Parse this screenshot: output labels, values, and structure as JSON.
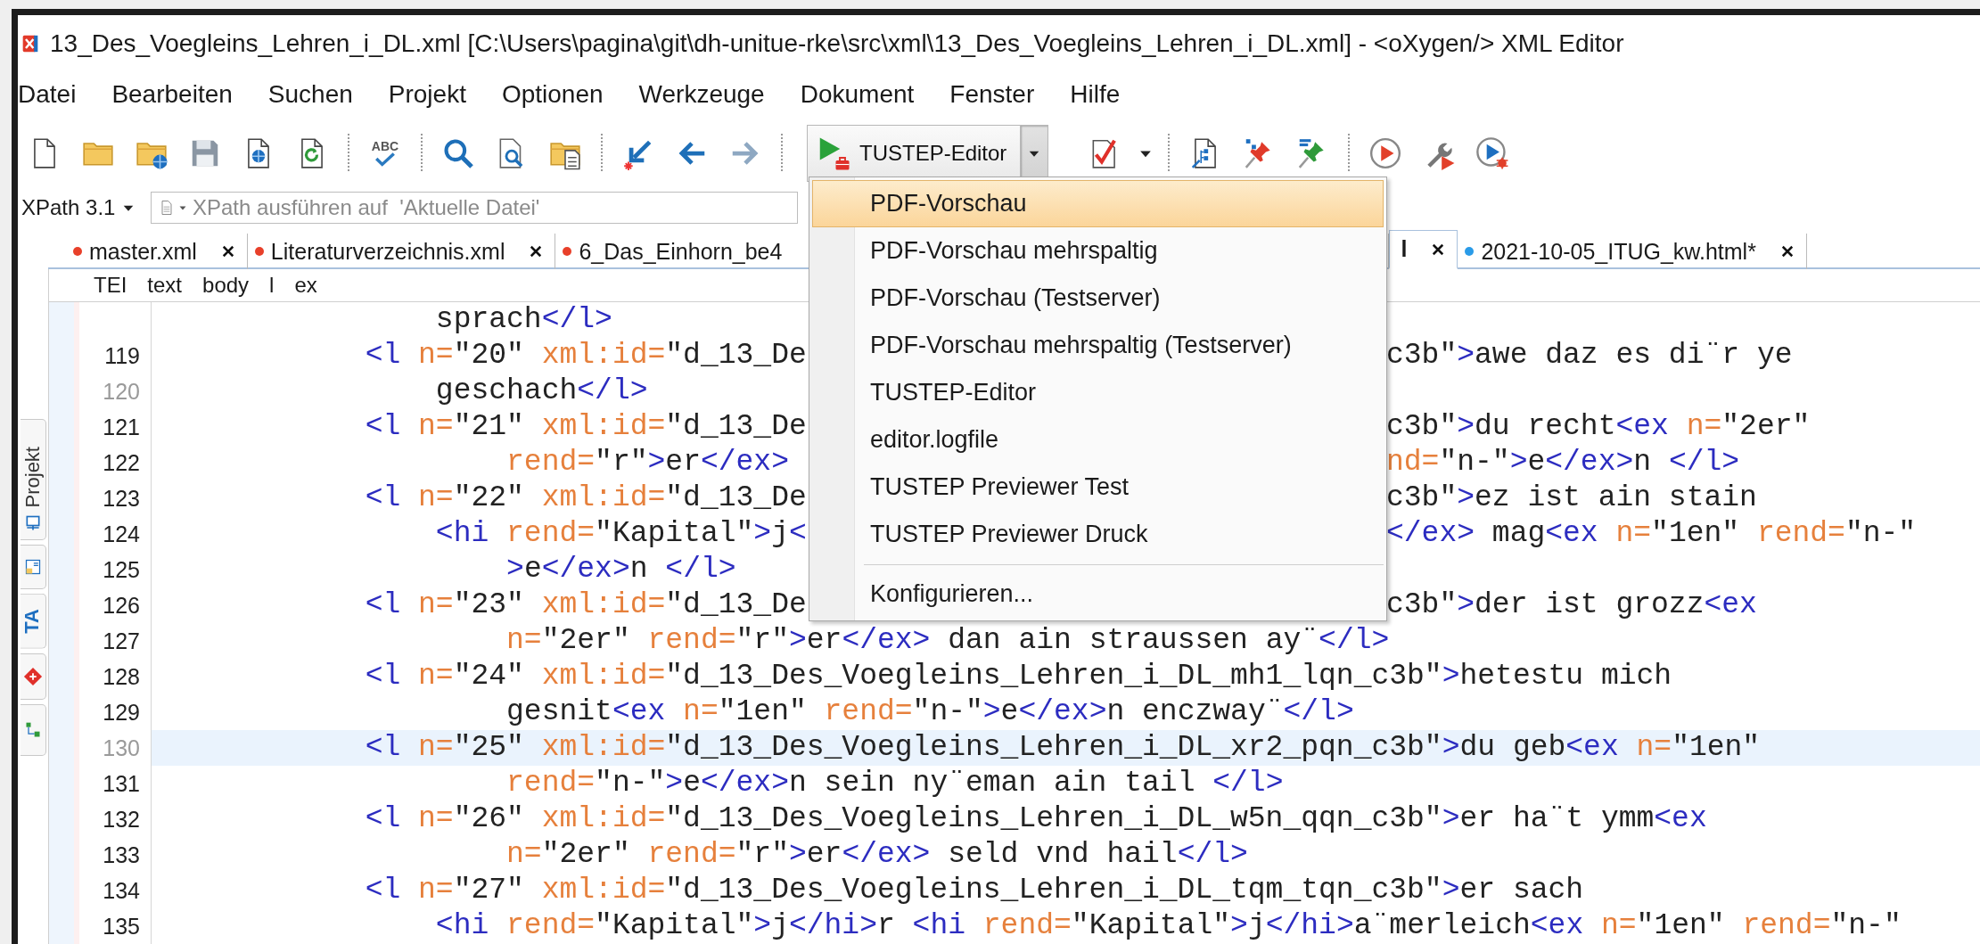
{
  "window": {
    "title": "13_Des_Voegleins_Lehren_i_DL.xml [C:\\Users\\pagina\\git\\dh-unitue-rke\\src\\xml\\13_Des_Voegleins_Lehren_i_DL.xml] - <oXygen/> XML Editor"
  },
  "menu": [
    "Datei",
    "Bearbeiten",
    "Suchen",
    "Projekt",
    "Optionen",
    "Werkzeuge",
    "Dokument",
    "Fenster",
    "Hilfe"
  ],
  "toolbar": {
    "spellcheck_label": "ABC",
    "run_button": {
      "label": "TUSTEP-Editor",
      "expanded": true
    }
  },
  "xpath": {
    "version": "XPath 3.1",
    "placeholder": "XPath ausführen auf  'Aktuelle Datei'"
  },
  "sidebar": {
    "tabs": [
      {
        "kind": "labeled",
        "label": "Projekt"
      },
      {
        "kind": "icon"
      },
      {
        "kind": "text",
        "label": "TA"
      },
      {
        "kind": "icon"
      },
      {
        "kind": "icon"
      }
    ]
  },
  "tabs": [
    {
      "label": "master.xml",
      "color": "#e8402a",
      "selected": false,
      "closable": true
    },
    {
      "label": "Literaturverzeichnis.xml",
      "color": "#e8402a",
      "selected": false,
      "closable": true
    },
    {
      "label": "6_Das_Einhorn_be4",
      "color": "#e8402a",
      "selected": false,
      "closable": false
    },
    {
      "label": "l",
      "selected": true,
      "closable": true
    },
    {
      "label": "2021-10-05_ITUG_kw.html*",
      "color": "#2a9be8",
      "selected": false,
      "closable": true
    }
  ],
  "breadcrumb": [
    "TEI",
    "text",
    "body",
    "l",
    "ex"
  ],
  "lines": [
    {
      "kind": "continuation",
      "current": false,
      "tokens": [
        {
          "kind": "text",
          "text": "sprach"
        },
        {
          "kind": "tag",
          "text": "</l>"
        }
      ]
    },
    {
      "kind": "element",
      "number": "119",
      "number_muted": false,
      "current": false,
      "tokens": [
        {
          "kind": "tag",
          "text": "<l "
        },
        {
          "kind": "attr",
          "text": "n="
        },
        {
          "kind": "text",
          "text": "\"20\" "
        },
        {
          "kind": "attr",
          "text": "xml:id="
        },
        {
          "kind": "text",
          "text": "\"d_13_De"
        }
      ],
      "tokens_right": [
        {
          "kind": "text",
          "text": "c3b\""
        },
        {
          "kind": "tag",
          "text": ">"
        },
        {
          "kind": "text",
          "text": "awe daz es di¨r ye"
        }
      ]
    },
    {
      "kind": "continuation",
      "number": "120",
      "number_muted": true,
      "current": false,
      "tokens": [
        {
          "kind": "text",
          "text": "geschach"
        },
        {
          "kind": "tag",
          "text": "</l>"
        }
      ]
    },
    {
      "kind": "element",
      "number": "121",
      "number_muted": false,
      "current": false,
      "tokens": [
        {
          "kind": "tag",
          "text": "<l "
        },
        {
          "kind": "attr",
          "text": "n="
        },
        {
          "kind": "text",
          "text": "\"21\" "
        },
        {
          "kind": "attr",
          "text": "xml:id="
        },
        {
          "kind": "text",
          "text": "\"d_13_De"
        }
      ],
      "tokens_right": [
        {
          "kind": "text",
          "text": "c3b\""
        },
        {
          "kind": "tag",
          "text": ">"
        },
        {
          "kind": "text",
          "text": "du recht"
        },
        {
          "kind": "tag",
          "text": "<ex "
        },
        {
          "kind": "attr",
          "text": "n="
        },
        {
          "kind": "text",
          "text": "\"2er\""
        }
      ]
    },
    {
      "kind": "attribute",
      "number": "122",
      "number_muted": false,
      "current": false,
      "tokens": [
        {
          "kind": "attr",
          "text": "rend="
        },
        {
          "kind": "text",
          "text": "\"r\""
        },
        {
          "kind": "tag",
          "text": ">"
        },
        {
          "kind": "text",
          "text": "er"
        },
        {
          "kind": "tag",
          "text": "</ex>"
        }
      ],
      "tokens_right": [
        {
          "kind": "attr",
          "text": "nd="
        },
        {
          "kind": "text",
          "text": "\"n-\""
        },
        {
          "kind": "tag",
          "text": ">"
        },
        {
          "kind": "text",
          "text": "e"
        },
        {
          "kind": "tag",
          "text": "</ex>"
        },
        {
          "kind": "text",
          "text": "n "
        },
        {
          "kind": "tag",
          "text": "</l>"
        }
      ]
    },
    {
      "kind": "element",
      "number": "123",
      "number_muted": false,
      "current": false,
      "tokens": [
        {
          "kind": "tag",
          "text": "<l "
        },
        {
          "kind": "attr",
          "text": "n="
        },
        {
          "kind": "text",
          "text": "\"22\" "
        },
        {
          "kind": "attr",
          "text": "xml:id="
        },
        {
          "kind": "text",
          "text": "\"d_13_De"
        }
      ],
      "tokens_right": [
        {
          "kind": "text",
          "text": "c3b\""
        },
        {
          "kind": "tag",
          "text": ">"
        },
        {
          "kind": "text",
          "text": "ez ist ain stain"
        }
      ]
    },
    {
      "kind": "continuation",
      "number": "124",
      "number_muted": false,
      "current": false,
      "tokens": [
        {
          "kind": "tag",
          "text": "<hi "
        },
        {
          "kind": "attr",
          "text": "rend="
        },
        {
          "kind": "text",
          "text": "\"Kapital\""
        },
        {
          "kind": "tag",
          "text": ">"
        },
        {
          "kind": "text",
          "text": "j"
        },
        {
          "kind": "tag",
          "text": "<"
        }
      ],
      "tokens_right": [
        {
          "kind": "tag",
          "text": "</ex>"
        },
        {
          "kind": "text",
          "text": " mag"
        },
        {
          "kind": "tag",
          "text": "<ex "
        },
        {
          "kind": "attr",
          "text": "n="
        },
        {
          "kind": "text",
          "text": "\"1en\" "
        },
        {
          "kind": "attr",
          "text": "rend="
        },
        {
          "kind": "text",
          "text": "\"n-\""
        }
      ]
    },
    {
      "kind": "attribute",
      "number": "125",
      "number_muted": false,
      "current": false,
      "tokens": [
        {
          "kind": "tag",
          "text": ">"
        },
        {
          "kind": "text",
          "text": "e"
        },
        {
          "kind": "tag",
          "text": "</ex>"
        },
        {
          "kind": "text",
          "text": "n "
        },
        {
          "kind": "tag",
          "text": "</l>"
        }
      ]
    },
    {
      "kind": "element",
      "number": "126",
      "number_muted": false,
      "current": false,
      "tokens": [
        {
          "kind": "tag",
          "text": "<l "
        },
        {
          "kind": "attr",
          "text": "n="
        },
        {
          "kind": "text",
          "text": "\"23\" "
        },
        {
          "kind": "attr",
          "text": "xml:id="
        },
        {
          "kind": "text",
          "text": "\"d_13_De"
        }
      ],
      "tokens_right": [
        {
          "kind": "text",
          "text": "c3b\""
        },
        {
          "kind": "tag",
          "text": ">"
        },
        {
          "kind": "text",
          "text": "der ist grozz"
        },
        {
          "kind": "tag",
          "text": "<ex"
        }
      ]
    },
    {
      "kind": "attribute",
      "number": "127",
      "number_muted": false,
      "current": false,
      "tokens": [
        {
          "kind": "attr",
          "text": "n="
        },
        {
          "kind": "text",
          "text": "\"2er\" "
        },
        {
          "kind": "attr",
          "text": "rend="
        },
        {
          "kind": "text",
          "text": "\"r\""
        },
        {
          "kind": "tag",
          "text": ">"
        },
        {
          "kind": "text",
          "text": "er"
        },
        {
          "kind": "tag",
          "text": "</ex>"
        },
        {
          "kind": "text",
          "text": " dan ain straussen ay¨"
        },
        {
          "kind": "tag",
          "text": "</l>"
        }
      ]
    },
    {
      "kind": "element",
      "number": "128",
      "number_muted": false,
      "current": false,
      "tokens": [
        {
          "kind": "tag",
          "text": "<l "
        },
        {
          "kind": "attr",
          "text": "n="
        },
        {
          "kind": "text",
          "text": "\"24\" "
        },
        {
          "kind": "attr",
          "text": "xml:id="
        },
        {
          "kind": "text",
          "text": "\"d_13_Des_Voegleins_Lehren_i_DL_mh1_lqn_c3b\""
        },
        {
          "kind": "tag",
          "text": ">"
        },
        {
          "kind": "text",
          "text": "hetestu mich"
        }
      ]
    },
    {
      "kind": "attribute",
      "number": "129",
      "number_muted": false,
      "current": false,
      "tokens": [
        {
          "kind": "text",
          "text": "gesnit"
        },
        {
          "kind": "tag",
          "text": "<ex "
        },
        {
          "kind": "attr",
          "text": "n="
        },
        {
          "kind": "text",
          "text": "\"1en\" "
        },
        {
          "kind": "attr",
          "text": "rend="
        },
        {
          "kind": "text",
          "text": "\"n-\""
        },
        {
          "kind": "tag",
          "text": ">"
        },
        {
          "kind": "text",
          "text": "e"
        },
        {
          "kind": "tag",
          "text": "</ex>"
        },
        {
          "kind": "text",
          "text": "n enczway¨"
        },
        {
          "kind": "tag",
          "text": "</l>"
        }
      ]
    },
    {
      "kind": "element",
      "number": "130",
      "number_muted": true,
      "current": true,
      "tokens": [
        {
          "kind": "tag",
          "text": "<l "
        },
        {
          "kind": "attr",
          "text": "n="
        },
        {
          "kind": "text",
          "text": "\"25\" "
        },
        {
          "kind": "attr",
          "text": "xml:id="
        },
        {
          "kind": "text",
          "text": "\"d_13_Des_Voegleins_Lehren_i_DL_xr2_pqn_c3b\""
        },
        {
          "kind": "tag",
          "text": ">"
        },
        {
          "kind": "text",
          "text": "du geb"
        },
        {
          "kind": "tag",
          "text": "<ex "
        },
        {
          "kind": "attr",
          "text": "n="
        },
        {
          "kind": "text",
          "text": "\"1en\""
        }
      ]
    },
    {
      "kind": "attribute",
      "number": "131",
      "number_muted": false,
      "current": false,
      "tokens": [
        {
          "kind": "attr",
          "text": "rend="
        },
        {
          "kind": "text",
          "text": "\"n-\""
        },
        {
          "kind": "tag",
          "text": ">"
        },
        {
          "kind": "text",
          "text": "e"
        },
        {
          "kind": "tag",
          "text": "</ex>"
        },
        {
          "kind": "text",
          "text": "n sein ny¨eman ain tail "
        },
        {
          "kind": "tag",
          "text": "</l>"
        }
      ]
    },
    {
      "kind": "element",
      "number": "132",
      "number_muted": false,
      "current": false,
      "tokens": [
        {
          "kind": "tag",
          "text": "<l "
        },
        {
          "kind": "attr",
          "text": "n="
        },
        {
          "kind": "text",
          "text": "\"26\" "
        },
        {
          "kind": "attr",
          "text": "xml:id="
        },
        {
          "kind": "text",
          "text": "\"d_13_Des_Voegleins_Lehren_i_DL_w5n_qqn_c3b\""
        },
        {
          "kind": "tag",
          "text": ">"
        },
        {
          "kind": "text",
          "text": "er ha¨t ymm"
        },
        {
          "kind": "tag",
          "text": "<ex"
        }
      ]
    },
    {
      "kind": "attribute",
      "number": "133",
      "number_muted": false,
      "current": false,
      "tokens": [
        {
          "kind": "attr",
          "text": "n="
        },
        {
          "kind": "text",
          "text": "\"2er\" "
        },
        {
          "kind": "attr",
          "text": "rend="
        },
        {
          "kind": "text",
          "text": "\"r\""
        },
        {
          "kind": "tag",
          "text": ">"
        },
        {
          "kind": "text",
          "text": "er"
        },
        {
          "kind": "tag",
          "text": "</ex>"
        },
        {
          "kind": "text",
          "text": " seld vnd hail"
        },
        {
          "kind": "tag",
          "text": "</l>"
        }
      ]
    },
    {
      "kind": "element",
      "number": "134",
      "number_muted": false,
      "current": false,
      "tokens": [
        {
          "kind": "tag",
          "text": "<l "
        },
        {
          "kind": "attr",
          "text": "n="
        },
        {
          "kind": "text",
          "text": "\"27\" "
        },
        {
          "kind": "attr",
          "text": "xml:id="
        },
        {
          "kind": "text",
          "text": "\"d_13_Des_Voegleins_Lehren_i_DL_tqm_tqn_c3b\""
        },
        {
          "kind": "tag",
          "text": ">"
        },
        {
          "kind": "text",
          "text": "er sach"
        }
      ]
    },
    {
      "kind": "continuation",
      "number": "135",
      "number_muted": false,
      "current": false,
      "tokens": [
        {
          "kind": "tag",
          "text": "<hi "
        },
        {
          "kind": "attr",
          "text": "rend="
        },
        {
          "kind": "text",
          "text": "\"Kapital\""
        },
        {
          "kind": "tag",
          "text": ">"
        },
        {
          "kind": "text",
          "text": "j"
        },
        {
          "kind": "tag",
          "text": "</hi>"
        },
        {
          "kind": "text",
          "text": "r "
        },
        {
          "kind": "tag",
          "text": "<hi "
        },
        {
          "kind": "attr",
          "text": "rend="
        },
        {
          "kind": "text",
          "text": "\"Kapital\""
        },
        {
          "kind": "tag",
          "text": ">"
        },
        {
          "kind": "text",
          "text": "j"
        },
        {
          "kind": "tag",
          "text": "</hi>"
        },
        {
          "kind": "text",
          "text": "a¨merleich"
        },
        {
          "kind": "tag",
          "text": "<ex "
        },
        {
          "kind": "attr",
          "text": "n="
        },
        {
          "kind": "text",
          "text": "\"1en\" "
        },
        {
          "kind": "attr",
          "text": "rend="
        },
        {
          "kind": "text",
          "text": "\"n-\""
        }
      ]
    }
  ],
  "dropdown": {
    "items": [
      {
        "kind": "item",
        "label": "PDF-Vorschau",
        "selected": true
      },
      {
        "kind": "item",
        "label": "PDF-Vorschau mehrspaltig",
        "selected": false
      },
      {
        "kind": "item",
        "label": "PDF-Vorschau (Testserver)",
        "selected": false
      },
      {
        "kind": "item",
        "label": "PDF-Vorschau mehrspaltig (Testserver)",
        "selected": false
      },
      {
        "kind": "item",
        "label": "TUSTEP-Editor",
        "selected": false
      },
      {
        "kind": "item",
        "label": "editor.logfile",
        "selected": false
      },
      {
        "kind": "item",
        "label": "TUSTEP Previewer Test",
        "selected": false
      },
      {
        "kind": "item",
        "label": "TUSTEP Previewer Druck",
        "selected": false
      },
      {
        "kind": "separator"
      },
      {
        "kind": "item",
        "label": "Konfigurieren...",
        "selected": false
      }
    ]
  }
}
